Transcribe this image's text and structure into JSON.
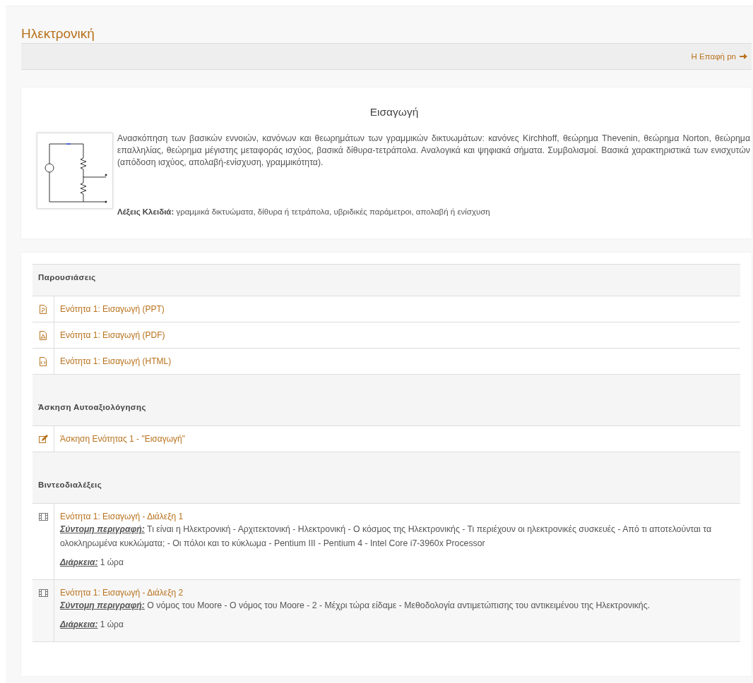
{
  "page_title": "Ηλεκτρονική",
  "nav": {
    "next_link": "Η Επαφή pn"
  },
  "intro": {
    "title": "Εισαγωγή",
    "text": "Ανασκόπηση των βασικών εννοιών, κανόνων και θεωρημάτων των γραμμικών δικτυωμάτων: κανόνες Kirchhoff, θεώρημα Thevenin, θεώρημα Norton, θεώρημα επαλληλίας, θεώρημα μέγιστης μεταφοράς ισχύος, βασικά δίθυρα-τετράπολα. Αναλογικά και ψηφιακά σήματα. Συμβολισμοί. Βασικά χαρακτηριστικά των ενισχυτών (απόδοση ισχύος, απολαβή-ενίσχυση, γραμμικότητα).",
    "keywords": "**Λέξεις Κλειδιά:** γραμμικά δικτυώματα, δίθυρα ή τετράπολα, υβριδικές παράμετροι, απολαβή ή ενίσχυση"
  },
  "sections": [
    {
      "title": "Παρουσιάσεις",
      "items": [
        {
          "kind": "ppt",
          "title": "Ενότητα 1: Εισαγωγή (PPT)"
        },
        {
          "kind": "pdf",
          "title": "Ενότητα 1: Εισαγωγή (PDF)"
        },
        {
          "kind": "html",
          "title": "Ενότητα 1: Εισαγωγή (HTML)"
        }
      ]
    },
    {
      "title": "Άσκηση Αυτοαξιολόγησης",
      "items": [
        {
          "kind": "exercise",
          "title": "Άσκηση Ενότητας 1 - \"Εισαγωγή\""
        }
      ]
    },
    {
      "title": "Βιντεοδιαλέξεις",
      "items": [
        {
          "kind": "video",
          "title": "Ενότητα 1: Εισαγωγή - Διάλεξη 1",
          "description_label": "Σύντομη περιγραφή:",
          "description": "Τι είναι η Ηλεκτρονική - Αρχιτεκτονική - Ηλεκτρονική - Ο κόσμος της Ηλεκτρονικής - Τι περιέχουν οι ηλεκτρονικές συσκευές - Από τι αποτελούνται τα ολοκληρωμένα κυκλώματα; - Οι πόλοι και το κύκλωμα - Pentium III - Pentium 4 - Intel Core i7-3960x Processor",
          "duration_label": "Διάρκεια:",
          "duration": "1 ώρα"
        },
        {
          "kind": "video",
          "title": "Ενότητα 1: Εισαγωγή - Διάλεξη 2",
          "description_label": "Σύντομη περιγραφή:",
          "description": "Ο νόμος του Moore - Ο νόμος του Moore - 2 - Μέχρι τώρα είδαμε - Μεθοδολογία αντιμετώπισης του αντικειμένου της Ηλεκτρονικής.",
          "duration_label": "Διάρκεια:",
          "duration": "1 ώρα"
        }
      ]
    }
  ]
}
